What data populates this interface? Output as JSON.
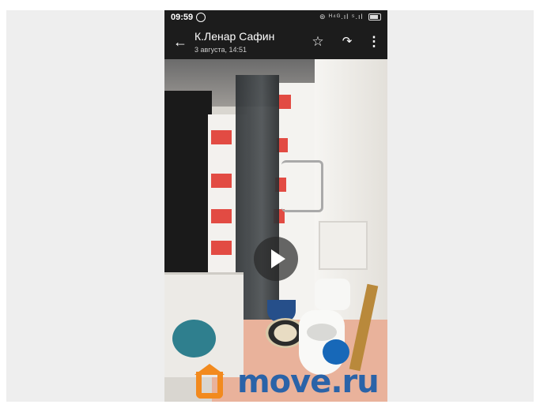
{
  "status_bar": {
    "time": "09:59",
    "right_indicators": "⊚ ᴴ⁴ᴳ.ıl ⁵.ıl"
  },
  "app_bar": {
    "back_label": "←",
    "sender": "К.Ленар Сафин",
    "timestamp": "3 августа, 14:51",
    "star_label": "☆",
    "forward_label": "↷",
    "menu_label": "⋮"
  },
  "watermark": {
    "text": "move.ru"
  },
  "colors": {
    "app_bar_bg": "#1c1c1c",
    "watermark_orange": "#f28a1e",
    "watermark_blue": "#2a63a8"
  }
}
